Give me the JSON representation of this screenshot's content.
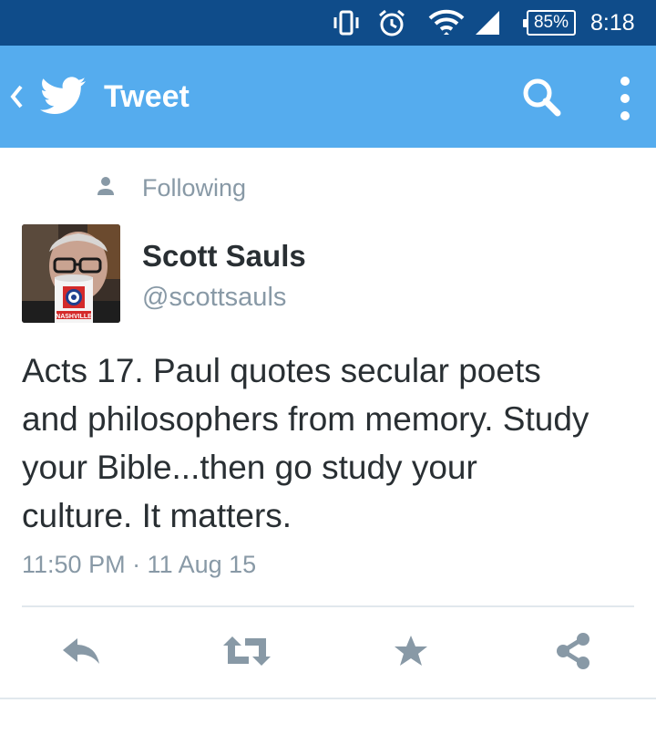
{
  "status_bar": {
    "icons": [
      "vibrate-icon",
      "alarm-icon",
      "wifi-icon",
      "signal-icon",
      "battery-icon"
    ],
    "battery": "85%",
    "time": "8:18"
  },
  "app_bar": {
    "title": "Tweet",
    "icons": [
      "back-chevron-icon",
      "twitter-bird-icon",
      "search-icon",
      "overflow-menu-icon"
    ],
    "color": "#55acee"
  },
  "tweet": {
    "social_context": "Following",
    "author_name": "Scott Sauls",
    "author_handle": "@scottsauls",
    "text_lines": [
      "Acts 17. Paul quotes secular poets",
      "and philosophers from memory. Study",
      "your Bible...then go study your",
      "culture. It matters."
    ],
    "timestamp": "11:50 PM · 11 Aug 15",
    "avatar_mug_text": "NASHVILLE"
  },
  "actions": {
    "icons": [
      "reply-icon",
      "retweet-icon",
      "favorite-star-icon",
      "share-icon"
    ],
    "color": "#8899a6"
  },
  "colors": {
    "status_bar": "#0f4c8a",
    "text_primary": "#292f33",
    "text_secondary": "#8899a6",
    "divider": "#e1e8ed"
  }
}
